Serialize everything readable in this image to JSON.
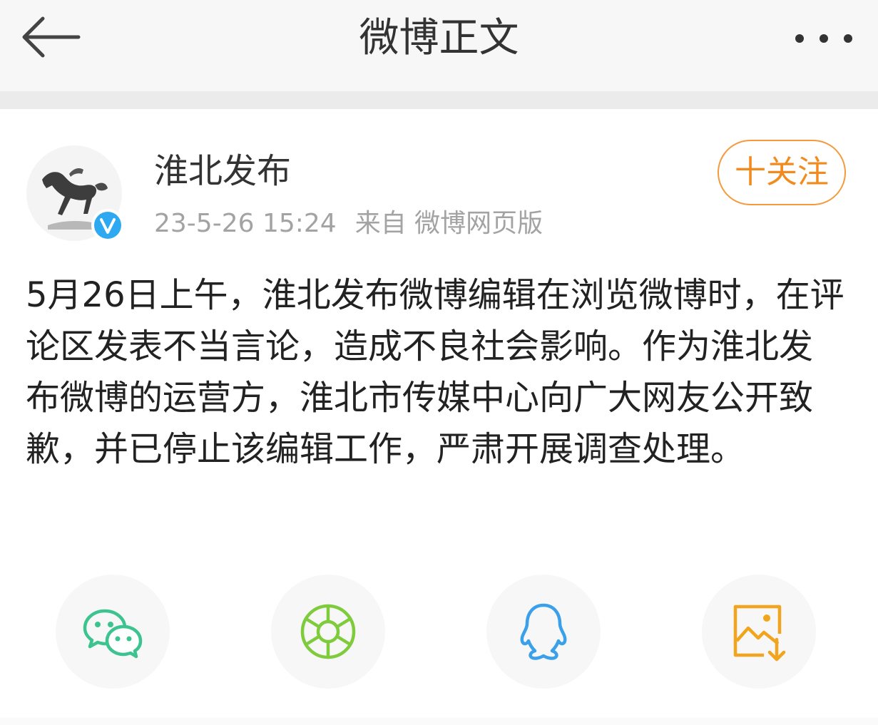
{
  "header": {
    "title": "微博正文",
    "back_icon": "arrow-left-icon",
    "more_icon": "more-dots-icon"
  },
  "post": {
    "author": "淮北发布",
    "avatar_icon": "horse-statue-avatar",
    "verified_icon": "verified-v-badge-icon",
    "timestamp": "23-5-26 15:24",
    "source": "来自 微博网页版",
    "follow_label": "十关注",
    "text": "5月26日上午，淮北发布微博编辑在浏览微博时，在评论区发表不当言论，造成不良社会影响。作为淮北发布微博的运营方，淮北市传媒中心向广大网友公开致歉，并已停止该编辑工作，严肃开展调查处理。"
  },
  "share": [
    {
      "icon": "wechat-icon",
      "color": "#3cc38f"
    },
    {
      "icon": "moments-icon",
      "color": "#7ecb3c"
    },
    {
      "icon": "qq-icon",
      "color": "#3aa0ea"
    },
    {
      "icon": "save-image-icon",
      "color": "#f2a51c"
    }
  ],
  "colors": {
    "accent": "#f28b1e",
    "verified": "#2ea8f0",
    "text": "#222222",
    "meta": "#a3a3a3"
  }
}
